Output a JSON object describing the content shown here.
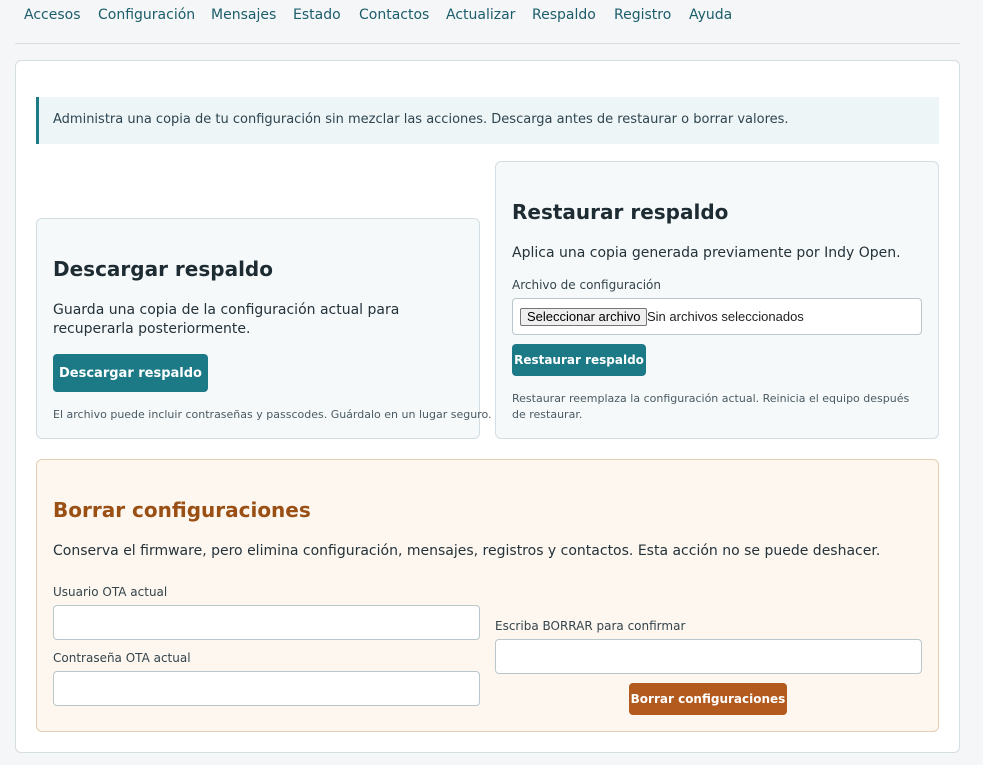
{
  "nav": {
    "items": [
      {
        "label": "Accesos"
      },
      {
        "label": "Configuración"
      },
      {
        "label": "Mensajes"
      },
      {
        "label": "Estado"
      },
      {
        "label": "Contactos"
      },
      {
        "label": "Actualizar"
      },
      {
        "label": "Respaldo"
      },
      {
        "label": "Registro"
      },
      {
        "label": "Ayuda"
      }
    ]
  },
  "info_text": "Administra una copia de tu configuración sin mezclar las acciones. Descarga antes de restaurar o borrar valores.",
  "download": {
    "title": "Descargar respaldo",
    "description": "Guarda una copia de la configuración actual para recuperarla posteriormente.",
    "button_label": "Descargar respaldo",
    "note": "El archivo puede incluir contraseñas y passcodes. Guárdalo en un lugar seguro."
  },
  "restore": {
    "title": "Restaurar respaldo",
    "description": "Aplica una copia generada previamente por Indy Open.",
    "file_label": "Archivo de configuración",
    "file_button": "Seleccionar archivo",
    "file_status": "Sin archivos seleccionados",
    "button_label": "Restaurar respaldo",
    "note": "Restaurar reemplaza la configuración actual. Reinicia el equipo después de restaurar."
  },
  "erase": {
    "title": "Borrar configuraciones",
    "description": "Conserva el firmware, pero elimina configuración, mensajes, registros y contactos. Esta acción no se puede deshacer.",
    "user_label": "Usuario OTA actual",
    "user_value": "",
    "password_label": "Contraseña OTA actual",
    "password_value": "",
    "confirm_label": "Escriba BORRAR para confirmar",
    "confirm_value": "",
    "button_label": "Borrar configuraciones"
  }
}
